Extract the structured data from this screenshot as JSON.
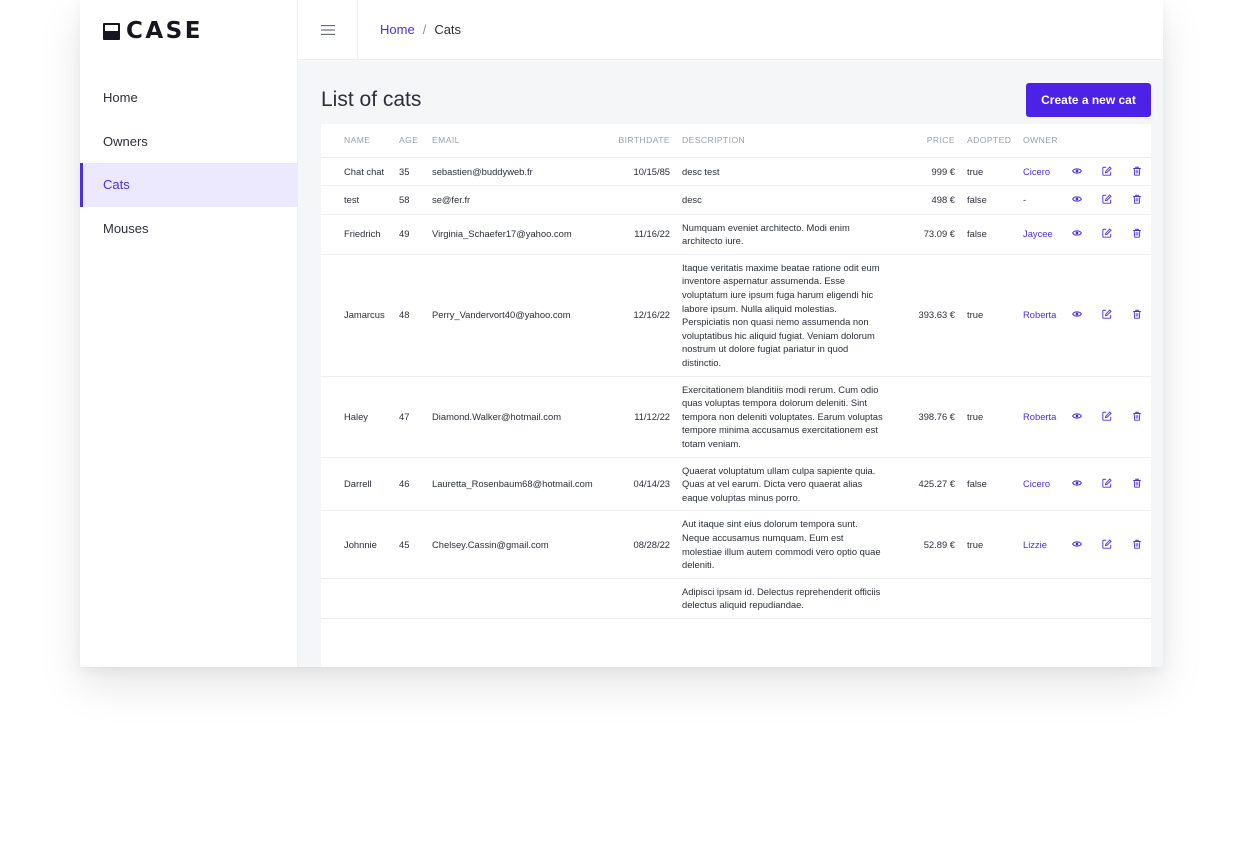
{
  "app": {
    "logo_text": "CASE"
  },
  "sidebar": {
    "items": [
      {
        "label": "Home",
        "active": false
      },
      {
        "label": "Owners",
        "active": false
      },
      {
        "label": "Cats",
        "active": true
      },
      {
        "label": "Mouses",
        "active": false
      }
    ]
  },
  "topbar": {
    "menu_icon": "hamburger-icon",
    "breadcrumb": {
      "link": "Home",
      "separator": "/",
      "current": "Cats"
    }
  },
  "main": {
    "title": "List of cats",
    "create_button": "Create a new cat"
  },
  "table": {
    "columns": [
      "Name",
      "Age",
      "Email",
      "Birthdate",
      "Description",
      "Price",
      "Adopted",
      "Owner"
    ],
    "rows": [
      {
        "name": "Chat chat",
        "age": "35",
        "email": "sebastien@buddyweb.fr",
        "birthdate": "10/15/85",
        "description": "desc test",
        "price": "999 €",
        "adopted": "true",
        "owner": "Cicero"
      },
      {
        "name": "test",
        "age": "58",
        "email": "se@fer.fr",
        "birthdate": "",
        "description": "desc",
        "price": "498 €",
        "adopted": "false",
        "owner": "-"
      },
      {
        "name": "Friedrich",
        "age": "49",
        "email": "Virginia_Schaefer17@yahoo.com",
        "birthdate": "11/16/22",
        "description": "Numquam eveniet architecto. Modi enim architecto iure.",
        "price": "73.09 €",
        "adopted": "false",
        "owner": "Jaycee"
      },
      {
        "name": "Jamarcus",
        "age": "48",
        "email": "Perry_Vandervort40@yahoo.com",
        "birthdate": "12/16/22",
        "description": "Itaque veritatis maxime beatae ratione odit eum inventore aspernatur assumenda. Esse voluptatum iure ipsum fuga harum eligendi hic labore ipsum. Nulla aliquid molestias. Perspiciatis non quasi nemo assumenda non voluptatibus hic aliquid fugiat. Veniam dolorum nostrum ut dolore fugiat pariatur in quod distinctio.",
        "price": "393.63 €",
        "adopted": "true",
        "owner": "Roberta"
      },
      {
        "name": "Haley",
        "age": "47",
        "email": "Diamond.Walker@hotmail.com",
        "birthdate": "11/12/22",
        "description": "Exercitationem blanditiis modi rerum. Cum odio quas voluptas tempora dolorum deleniti. Sint tempora non deleniti voluptates. Earum voluptas tempore minima accusamus exercitationem est totam veniam.",
        "price": "398.76 €",
        "adopted": "true",
        "owner": "Roberta"
      },
      {
        "name": "Darrell",
        "age": "46",
        "email": "Lauretta_Rosenbaum68@hotmail.com",
        "birthdate": "04/14/23",
        "description": "Quaerat voluptatum ullam culpa sapiente quia. Quas at vel earum. Dicta vero quaerat alias eaque voluptas minus porro.",
        "price": "425.27 €",
        "adopted": "false",
        "owner": "Cicero"
      },
      {
        "name": "Johnnie",
        "age": "45",
        "email": "Chelsey.Cassin@gmail.com",
        "birthdate": "08/28/22",
        "description": "Aut itaque sint eius dolorum tempora sunt. Neque accusamus numquam. Eum est molestiae illum autem commodi vero optio quae deleniti.",
        "price": "52.89 €",
        "adopted": "true",
        "owner": "Lizzie"
      },
      {
        "name": "",
        "age": "",
        "email": "",
        "birthdate": "",
        "description": "Adipisci ipsam id. Delectus reprehenderit officiis delectus aliquid repudiandae.",
        "price": "",
        "adopted": "",
        "owner": ""
      }
    ],
    "row_actions": [
      "eye-icon",
      "edit-icon",
      "trash-icon"
    ]
  },
  "colors": {
    "accent": "#4b22e6",
    "active_bg": "#ece8fd",
    "page_bg": "#f5f6f8"
  }
}
